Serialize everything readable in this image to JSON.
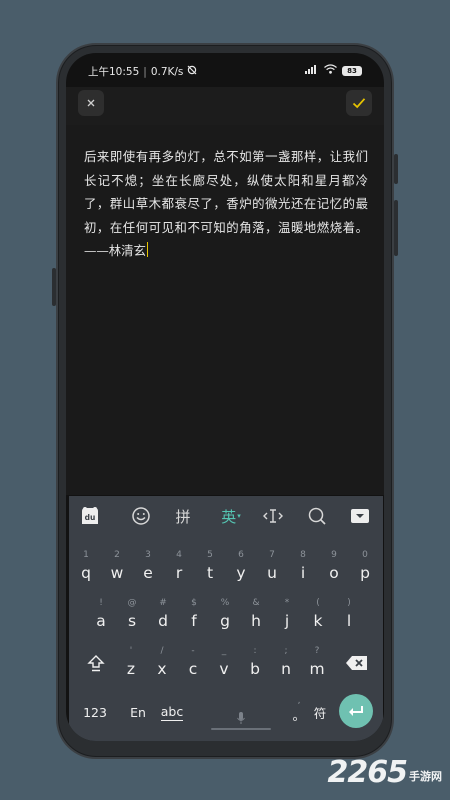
{
  "status_bar": {
    "time": "上午10:55",
    "separator": "|",
    "network_speed": "0.7K/s",
    "battery_level": "83"
  },
  "toolbar": {
    "close_icon": "close-icon",
    "confirm_icon": "checkmark-icon",
    "confirm_color": "#e6c300"
  },
  "editor": {
    "content": "后来即使有再多的灯，总不如第一盏那样，让我们长记不熄；坐在长廊尽处，纵使太阳和星月都冷了，群山草木都衰尽了，香炉的微光还在记忆的最初，在任何可见和不可知的角落，温暖地燃烧着。——林清玄"
  },
  "keyboard": {
    "toolbar": {
      "pinyin_label": "拼",
      "english_label": "英"
    },
    "row1": [
      {
        "key": "q",
        "hint": "1"
      },
      {
        "key": "w",
        "hint": "2"
      },
      {
        "key": "e",
        "hint": "3"
      },
      {
        "key": "r",
        "hint": "4"
      },
      {
        "key": "t",
        "hint": "5"
      },
      {
        "key": "y",
        "hint": "6"
      },
      {
        "key": "u",
        "hint": "7"
      },
      {
        "key": "i",
        "hint": "8"
      },
      {
        "key": "o",
        "hint": "9"
      },
      {
        "key": "p",
        "hint": "0"
      }
    ],
    "row2": [
      {
        "key": "a",
        "hint": "!"
      },
      {
        "key": "s",
        "hint": "@"
      },
      {
        "key": "d",
        "hint": "#"
      },
      {
        "key": "f",
        "hint": "$"
      },
      {
        "key": "g",
        "hint": "%"
      },
      {
        "key": "h",
        "hint": "&"
      },
      {
        "key": "j",
        "hint": "*"
      },
      {
        "key": "k",
        "hint": "("
      },
      {
        "key": "l",
        "hint": ")"
      }
    ],
    "row3": [
      {
        "key": "z",
        "hint": "'"
      },
      {
        "key": "x",
        "hint": "/"
      },
      {
        "key": "c",
        "hint": "-"
      },
      {
        "key": "v",
        "hint": "_"
      },
      {
        "key": "b",
        "hint": ":"
      },
      {
        "key": "n",
        "hint": ";"
      },
      {
        "key": "m",
        "hint": "?"
      }
    ],
    "bottom": {
      "numbers_label": "123",
      "en_label": "En",
      "abc_label": "abc",
      "period_label": "。",
      "period_hint": ",",
      "symbols_label": "符"
    },
    "accent_color": "#6fc1b1"
  },
  "watermark": {
    "number": "2265",
    "text": "手游网"
  }
}
